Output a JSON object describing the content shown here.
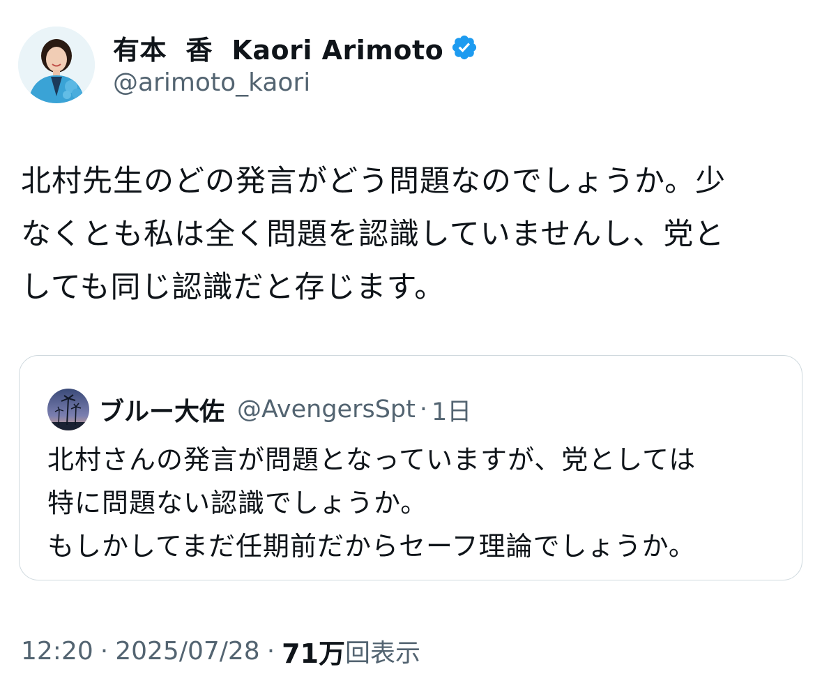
{
  "author": {
    "display_name": "有本  香  Kaori Arimoto",
    "handle": "@arimoto_kaori",
    "verified_icon": "verified-badge-icon",
    "verified_color": "#1d9bf0"
  },
  "tweet": {
    "text_lines": [
      "北村先生のどの発言がどう問題なのでしょうか。少",
      "なくとも私は全く問題を認識していませんし、党と",
      "しても同じ認識だと存じます。"
    ]
  },
  "quote": {
    "display_name": "ブルー大佐",
    "handle": "@AvengersSpt",
    "dot": "·",
    "time": "1日",
    "text_lines": [
      "北村さんの発言が問題となっていますが、党としては",
      "特に問題ない認識でしょうか。",
      "もしかしてまだ任期前だからセーフ理論でしょうか。"
    ]
  },
  "meta": {
    "time": "12:20",
    "sep": "·",
    "date": "2025/07/28",
    "views_count": "71万",
    "views_label": "回表示"
  },
  "colors": {
    "text_primary": "#0f1419",
    "text_secondary": "#536471",
    "border": "#cfd9de"
  }
}
